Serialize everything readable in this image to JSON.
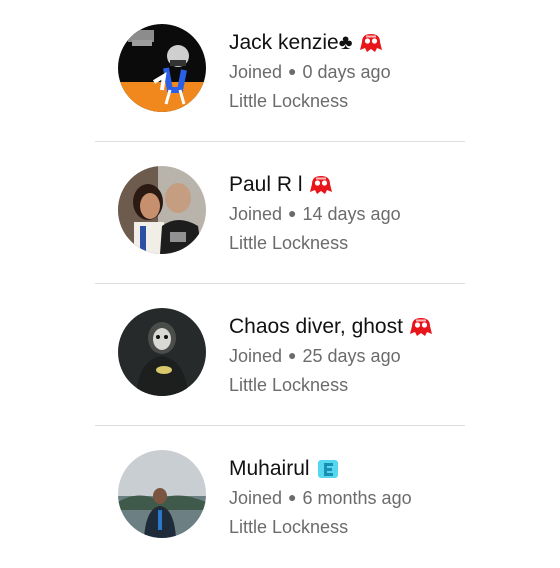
{
  "members": [
    {
      "name": "Jack kenzie♣",
      "joined_label": "Joined",
      "joined_ago": "0 days ago",
      "group": "Little Lockness",
      "avatar": "avatar-cartoon-figure",
      "badge_icon": "red-emoji-badge-icon"
    },
    {
      "name": "Paul R l",
      "joined_label": "Joined",
      "joined_ago": "14 days ago",
      "group": "Little Lockness",
      "avatar": "avatar-couple-selfie",
      "badge_icon": "red-emoji-badge-icon"
    },
    {
      "name": "Chaos diver, ghost",
      "joined_label": "Joined",
      "joined_ago": "25 days ago",
      "group": "Little Lockness",
      "avatar": "avatar-masked-soldier",
      "badge_icon": "red-emoji-badge-icon"
    },
    {
      "name": "Muhairul",
      "joined_label": "Joined",
      "joined_ago": "6 months ago",
      "group": "Little Lockness",
      "avatar": "avatar-person-outdoors",
      "badge_icon": "cyan-letter-badge-icon"
    }
  ],
  "colors": {
    "name_text": "#111111",
    "meta_text": "#6b6b6b",
    "divider": "#dddddd",
    "red_badge": "#e8161b",
    "cyan_badge": "#55d8ef"
  }
}
